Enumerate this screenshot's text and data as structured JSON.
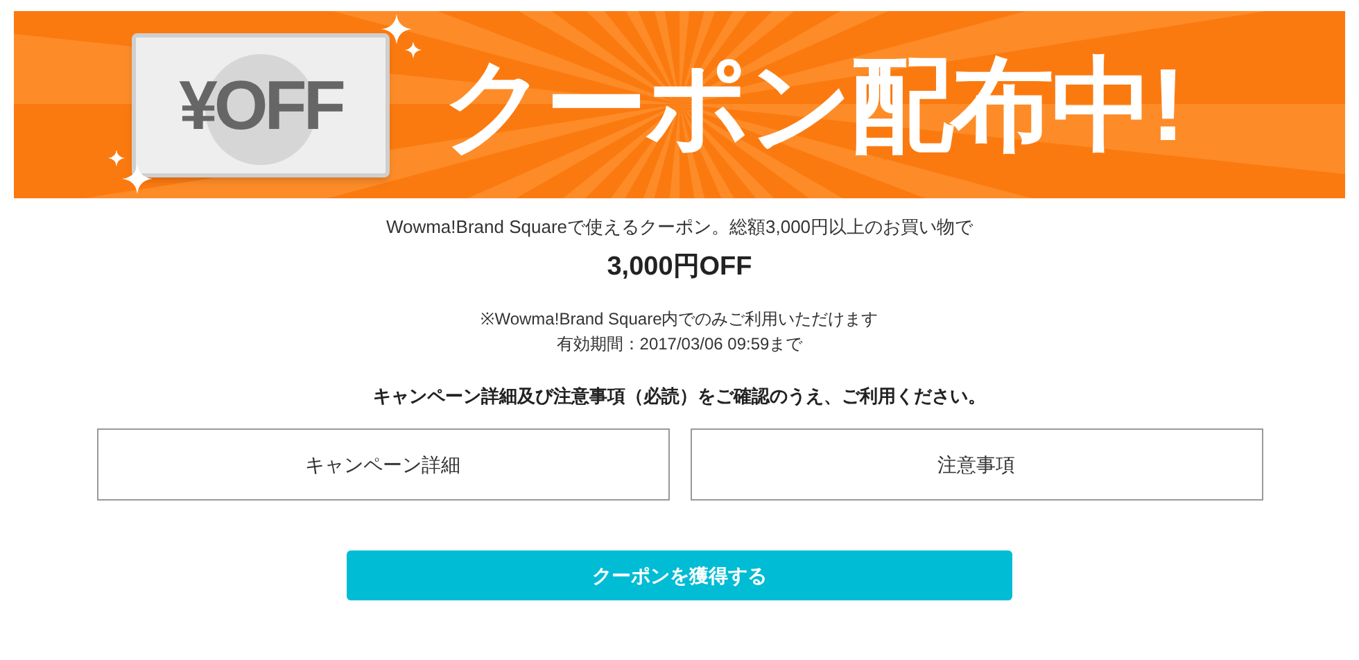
{
  "banner": {
    "coupon_label": "¥OFF",
    "title": "クーポン配布中!"
  },
  "description": "Wowma!Brand Squareで使えるクーポン。総額3,000円以上のお買い物で",
  "discount": "3,000円OFF",
  "notes": [
    "※Wowma!Brand Square内でのみご利用いただけます",
    "有効期間：2017/03/06 09:59まで"
  ],
  "instruction": "キャンペーン詳細及び注意事項（必読）をご確認のうえ、ご利用ください。",
  "links": [
    "キャンペーン詳細",
    "注意事項"
  ],
  "cta_button": "クーポンを獲得する"
}
